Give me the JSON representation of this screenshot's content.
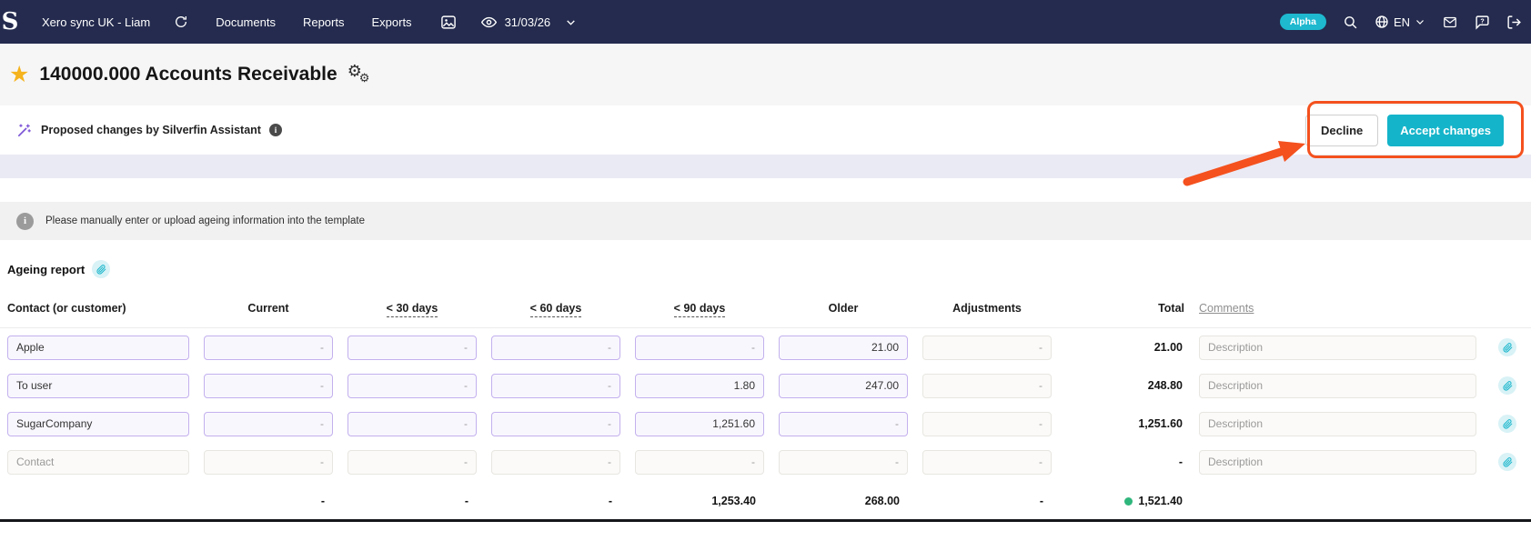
{
  "navbar": {
    "logo": "S",
    "company": "Xero sync UK - Liam",
    "menu": [
      "Documents",
      "Reports",
      "Exports"
    ],
    "date": "31/03/26",
    "badge": "Alpha",
    "lang": "EN"
  },
  "header": {
    "title": "140000.000 Accounts Receivable"
  },
  "assistant": {
    "label": "Proposed changes by Silverfin Assistant",
    "decline": "Decline",
    "accept": "Accept changes"
  },
  "banner": {
    "text": "Please manually enter or upload ageing information into the template"
  },
  "section": {
    "title": "Ageing report"
  },
  "table": {
    "headers": [
      "Contact (or customer)",
      "Current",
      "< 30 days",
      "< 60 days",
      "< 90 days",
      "Older",
      "Adjustments",
      "Total",
      "Comments"
    ],
    "rows": [
      {
        "name": "Apple",
        "current": "-",
        "d30": "-",
        "d60": "-",
        "d90": "-",
        "older": "21.00",
        "adjustments": "-",
        "total": "21.00",
        "comment_placeholder": "Description"
      },
      {
        "name": "To user",
        "current": "-",
        "d30": "-",
        "d60": "-",
        "d90": "1.80",
        "older": "247.00",
        "adjustments": "-",
        "total": "248.80",
        "comment_placeholder": "Description"
      },
      {
        "name": "SugarCompany",
        "current": "-",
        "d30": "-",
        "d60": "-",
        "d90": "1,251.60",
        "older": "-",
        "adjustments": "-",
        "total": "1,251.60",
        "comment_placeholder": "Description"
      },
      {
        "name_placeholder": "Contact",
        "current": "-",
        "d30": "-",
        "d60": "-",
        "d90": "-",
        "older": "-",
        "adjustments": "-",
        "total": "-",
        "comment_placeholder": "Description"
      }
    ],
    "totals": {
      "current": "-",
      "d30": "-",
      "d60": "-",
      "d90": "1,253.40",
      "older": "268.00",
      "adjustments": "-",
      "total": "1,521.40"
    }
  },
  "colors": {
    "navbar": "#242b4e",
    "accent_teal": "#14b4ca",
    "proposed_purple": "#c3b1ee",
    "annotation_orange": "#f4511e",
    "star_yellow": "#f5b31d",
    "total_green": "#2fb67c"
  }
}
